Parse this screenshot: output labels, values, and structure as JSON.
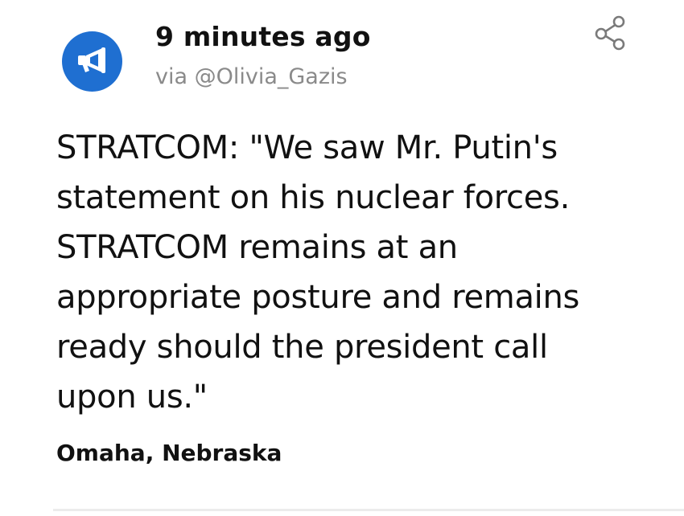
{
  "post": {
    "avatar_icon": "megaphone-icon",
    "avatar_color": "#1f6fd1",
    "time": "9 minutes ago",
    "via": "via @Olivia_Gazis",
    "share_icon": "share-icon",
    "body": "STRATCOM: \"We saw Mr. Putin's statement on his nuclear forces. STRATCOM remains at an appropriate posture and remains ready should the president call upon us.\"",
    "location": "Omaha, Nebraska"
  }
}
